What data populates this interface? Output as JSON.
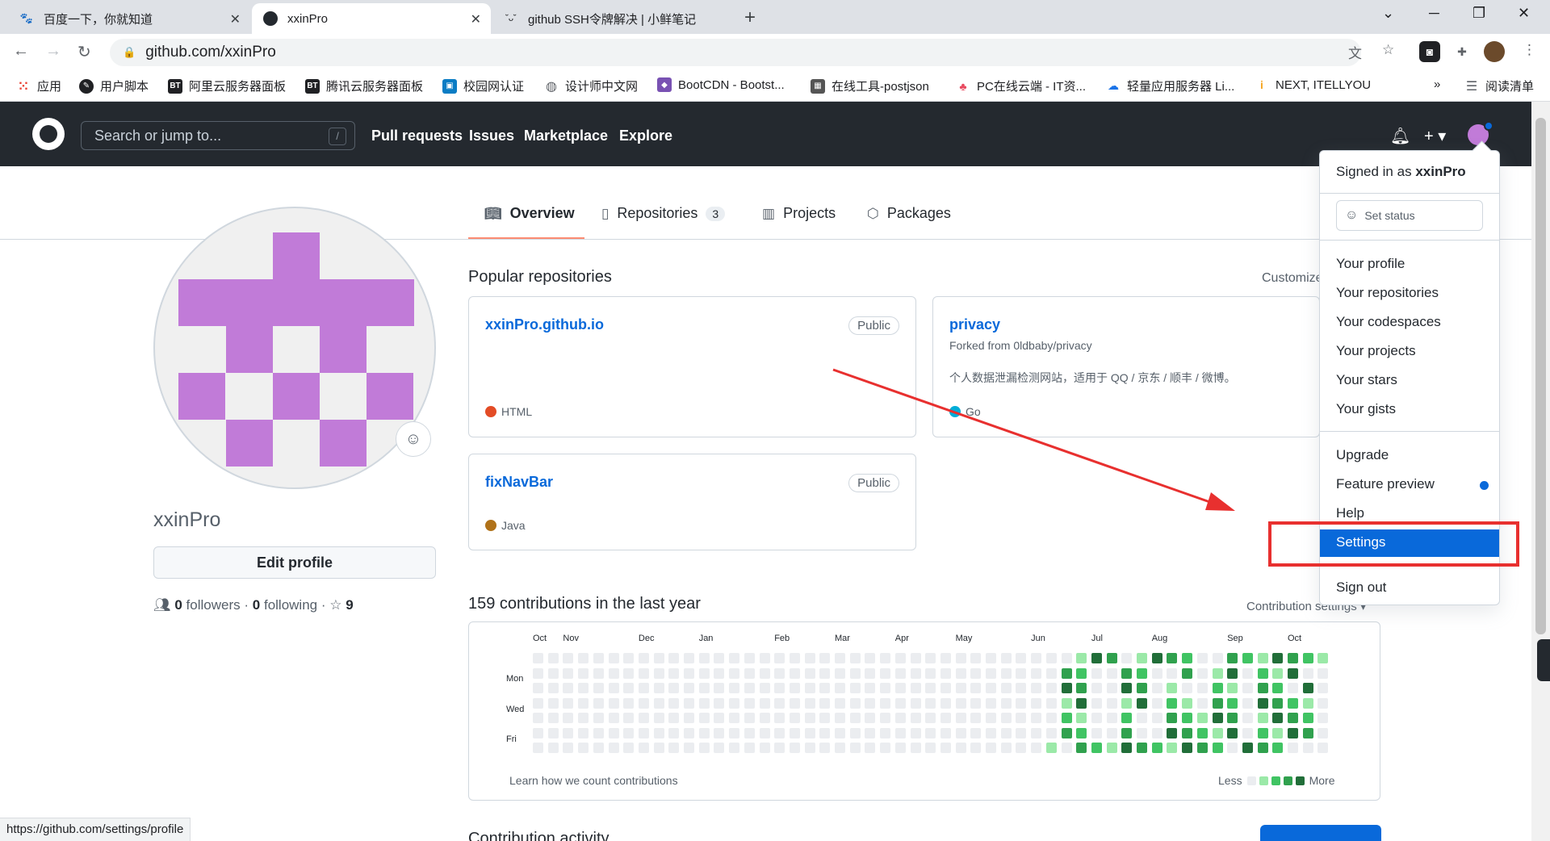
{
  "browser": {
    "tabs": [
      {
        "title": "百度一下，你就知道",
        "icon": "baidu-paw-icon"
      },
      {
        "title": "xxinPro",
        "icon": "github-icon"
      },
      {
        "title": "github SSH令牌解决 | 小鲜笔记",
        "icon": "site-face-icon"
      }
    ],
    "url": "github.com/xxinPro",
    "bookmarks": [
      "应用",
      "用户脚本",
      "阿里云服务器面板",
      "腾讯云服务器面板",
      "校园网认证",
      "设计师中文网",
      "BootCDN - Bootst...",
      "在线工具-postjson",
      "PC在线云端 - IT资...",
      "轻量应用服务器 Li...",
      "NEXT, ITELLYOU"
    ],
    "reading_list": "阅读清单",
    "more_bookmarks": "»",
    "status_url": "https://github.com/settings/profile"
  },
  "github": {
    "search_placeholder": "Search or jump to...",
    "search_shortcut": "/",
    "nav": [
      "Pull requests",
      "Issues",
      "Marketplace",
      "Explore"
    ]
  },
  "profile": {
    "tabs": [
      {
        "label": "Overview",
        "icon": "book-icon"
      },
      {
        "label": "Repositories",
        "icon": "repo-icon",
        "count": "3"
      },
      {
        "label": "Projects",
        "icon": "table-icon"
      },
      {
        "label": "Packages",
        "icon": "package-icon"
      }
    ],
    "username": "xxinPro",
    "edit_button": "Edit profile",
    "followers_count": "0",
    "followers_label": "followers",
    "following_count": "0",
    "following_label": "following",
    "stars_count": "9",
    "separator": "·"
  },
  "popular": {
    "title": "Popular repositories",
    "customize": "Customize",
    "repos": [
      {
        "name": "xxinPro.github.io",
        "badge": "Public",
        "lang": "HTML",
        "lang_color": "#e34c26"
      },
      {
        "name": "privacy",
        "forked": "Forked from 0ldbaby/privacy",
        "desc": "个人数据泄漏检测网站，适用于 QQ / 京东 / 顺丰 / 微博。",
        "lang": "Go",
        "lang_color": "#00ADD8"
      },
      {
        "name": "fixNavBar",
        "badge": "Public",
        "lang": "Java",
        "lang_color": "#b07219"
      }
    ]
  },
  "contributions": {
    "title": "159 contributions in the last year",
    "settings": "Contribution settings ▾",
    "months": [
      "Oct",
      "Nov",
      "Dec",
      "Jan",
      "Feb",
      "Mar",
      "Apr",
      "May",
      "Jun",
      "Jul",
      "Aug",
      "Sep",
      "Oct"
    ],
    "days": [
      "Mon",
      "Wed",
      "Fri"
    ],
    "learn": "Learn how we count contributions",
    "less": "Less",
    "more": "More",
    "level_colors": [
      "#ebedf0",
      "#9be9a8",
      "#40c463",
      "#30a14e",
      "#216e39"
    ]
  },
  "activity": {
    "title": "Contribution activity"
  },
  "dropdown": {
    "signed_prefix": "Signed in as",
    "signed_user": "xxinPro",
    "set_status": "Set status",
    "group1": [
      "Your profile",
      "Your repositories",
      "Your codespaces",
      "Your projects",
      "Your stars",
      "Your gists"
    ],
    "group2": [
      "Upgrade",
      "Feature preview",
      "Help",
      "Settings"
    ],
    "sign_out": "Sign out",
    "highlighted": "Settings"
  },
  "colors": {
    "header": "#24292f",
    "link": "#0969da",
    "annotation_red": "#e8302f"
  }
}
